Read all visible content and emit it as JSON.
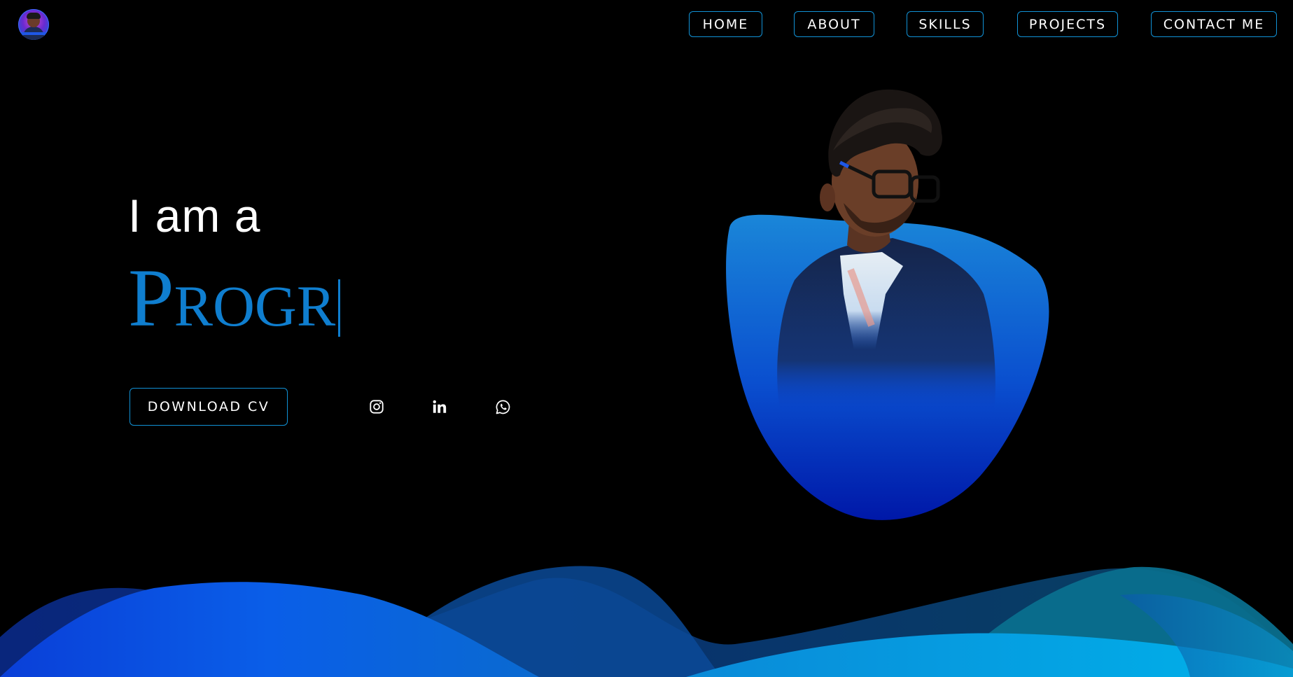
{
  "nav": {
    "items": [
      {
        "label": "HOME"
      },
      {
        "label": "ABOUT"
      },
      {
        "label": "SKILLS"
      },
      {
        "label": "PROJECTS"
      },
      {
        "label": "CONTACT ME"
      }
    ]
  },
  "hero": {
    "intro": "I am a",
    "typed_text": "Progr",
    "download_label": "DOWNLOAD CV"
  },
  "social": [
    {
      "icon": "instagram-icon"
    },
    {
      "icon": "linkedin-icon"
    },
    {
      "icon": "whatsapp-icon"
    }
  ],
  "colors": {
    "background": "#000000",
    "accent": "#0f7ecf",
    "border": "#1192d6",
    "blob_top": "#1a86d8",
    "blob_bottom": "#0018a8"
  }
}
